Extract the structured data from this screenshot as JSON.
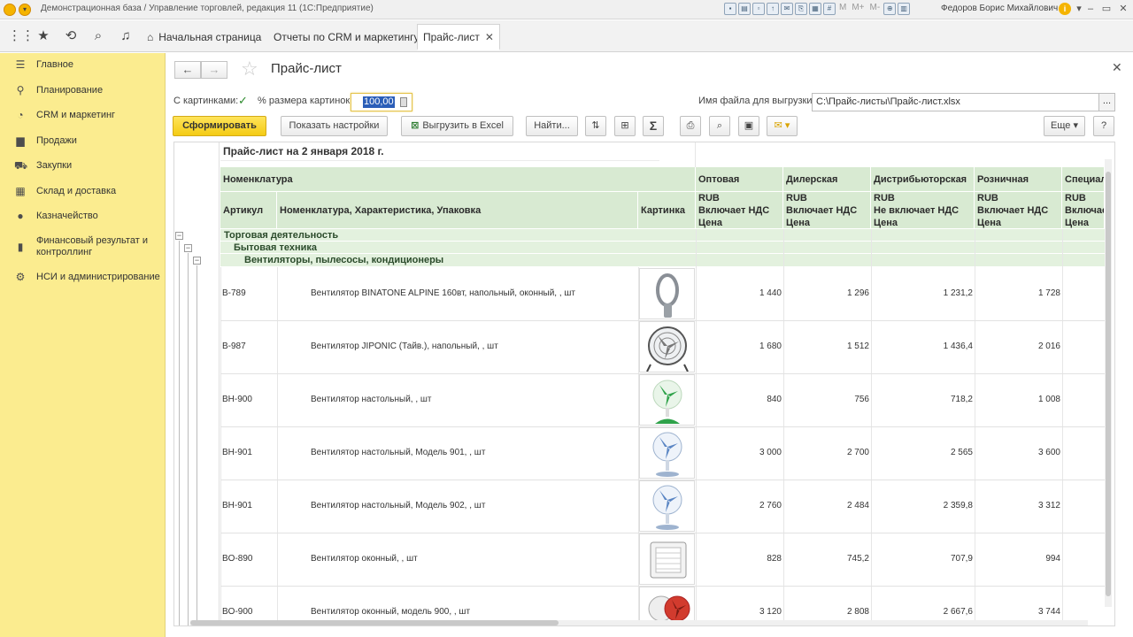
{
  "window": {
    "title": "Демонстрационная база / Управление торговлей, редакция 11  (1С:Предприятие)",
    "user": "Федоров Борис Михайлович",
    "toolbar_text": [
      "M",
      "M+",
      "M-"
    ]
  },
  "tabs": [
    {
      "label": "Начальная страница"
    },
    {
      "label": "Отчеты по CRM и маркетингу"
    },
    {
      "label": "Прайс-лист"
    }
  ],
  "sidebar": {
    "items": [
      {
        "label": "Главное",
        "icon": "menu-icon"
      },
      {
        "label": "Планирование",
        "icon": "planning-icon"
      },
      {
        "label": "CRM и маркетинг",
        "icon": "pie-chart-icon"
      },
      {
        "label": "Продажи",
        "icon": "bag-icon"
      },
      {
        "label": "Закупки",
        "icon": "cart-icon"
      },
      {
        "label": "Склад и доставка",
        "icon": "warehouse-icon"
      },
      {
        "label": "Казначейство",
        "icon": "coin-icon"
      },
      {
        "label": "Финансовый результат и контроллинг",
        "icon": "bar-chart-icon"
      },
      {
        "label": "НСИ и администрирование",
        "icon": "gear-icon"
      }
    ]
  },
  "form": {
    "title": "Прайс-лист",
    "with_images_label": "С картинками:",
    "with_images_checked": true,
    "image_size_label": "% размера картинок:",
    "image_size_value": "100,00",
    "export_file_label": "Имя файла для выгрузки:",
    "export_file_value": "C:\\Прайс-листы\\Прайс-лист.xlsx",
    "file_button": "..."
  },
  "buttons": {
    "generate": "Сформировать",
    "show_settings": "Показать настройки",
    "export_excel": "Выгрузить в Excel",
    "find": "Найти...",
    "more": "Еще",
    "help": "?"
  },
  "report": {
    "title": "Прайс-лист на 2 января 2018 г.",
    "header_nomenclature": "Номенклатура",
    "header_article": "Артикул",
    "header_name": "Номенклатура, Характеристика, Упаковка",
    "header_image": "Картинка",
    "price_columns": [
      {
        "name": "Оптовая",
        "currency": "RUB",
        "vat": "Включает НДС",
        "unit": "Цена"
      },
      {
        "name": "Дилерская",
        "currency": "RUB",
        "vat": "Включает НДС",
        "unit": "Цена"
      },
      {
        "name": "Дистрибьюторская",
        "currency": "RUB",
        "vat": "Не включает НДС",
        "unit": "Цена"
      },
      {
        "name": "Розничная",
        "currency": "RUB",
        "vat": "Включает НДС",
        "unit": "Цена"
      },
      {
        "name": "Специал",
        "currency": "RUB",
        "vat": "Включае",
        "unit": "Цена"
      }
    ],
    "groups": [
      {
        "label": "Торговая деятельность"
      },
      {
        "label": "Бытовая техника"
      },
      {
        "label": "Вентиляторы, пылесосы, кондиционеры"
      }
    ],
    "rows": [
      {
        "article": "B-789",
        "name": "Вентилятор BINATONE ALPINE 160вт, напольный, оконный, , шт",
        "prices": [
          "1 440",
          "1 296",
          "1 231,2",
          "1 728"
        ],
        "image": "bladeless-fan"
      },
      {
        "article": "B-987",
        "name": "Вентилятор JIPONIC (Тайв.), напольный, , шт",
        "prices": [
          "1 680",
          "1 512",
          "1 436,4",
          "2 016"
        ],
        "image": "floor-fan"
      },
      {
        "article": "BH-900",
        "name": "Вентилятор настольный, , шт",
        "prices": [
          "840",
          "756",
          "718,2",
          "1 008"
        ],
        "image": "desk-fan-green"
      },
      {
        "article": "BH-901",
        "name": "Вентилятор настольный, Модель 901, , шт",
        "prices": [
          "3 000",
          "2 700",
          "2 565",
          "3 600"
        ],
        "image": "desk-fan-blue"
      },
      {
        "article": "BH-901",
        "name": "Вентилятор настольный, Модель 902, , шт",
        "prices": [
          "2 760",
          "2 484",
          "2 359,8",
          "3 312"
        ],
        "image": "desk-fan-blue"
      },
      {
        "article": "BO-890",
        "name": "Вентилятор оконный, , шт",
        "prices": [
          "828",
          "745,2",
          "707,9",
          "994"
        ],
        "image": "window-fan"
      },
      {
        "article": "BO-900",
        "name": "Вентилятор оконный, модель 900, , шт",
        "prices": [
          "3 120",
          "2 808",
          "2 667,6",
          "3 744"
        ],
        "image": "window-fan-red"
      }
    ]
  }
}
